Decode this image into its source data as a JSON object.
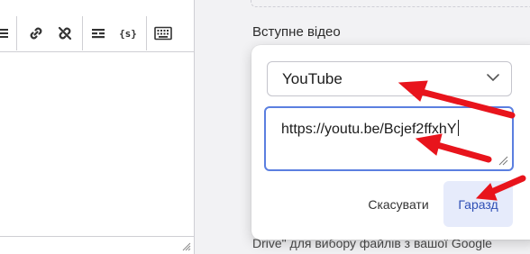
{
  "toolbar": {
    "icons": [
      "list-icon",
      "link-icon",
      "unlink-icon",
      "horizontal-rule-icon",
      "code-braces-icon",
      "keyboard-icon"
    ],
    "code_glyph": "{s}"
  },
  "section": {
    "label": "Вступне відео",
    "helper_text": "Drive\" для вибору файлів з вашої Google"
  },
  "video_dialog": {
    "source_select": {
      "value": "YouTube"
    },
    "url_input": {
      "value": "https://youtu.be/Bcjef2ffxhY"
    },
    "cancel_label": "Скасувати",
    "ok_label": "Гаразд"
  },
  "colors": {
    "accent_border": "#5b7fe0",
    "ok_button_bg": "#e6ebfb",
    "ok_button_text": "#2f4fb5",
    "annotation_arrow": "#e8141c"
  }
}
